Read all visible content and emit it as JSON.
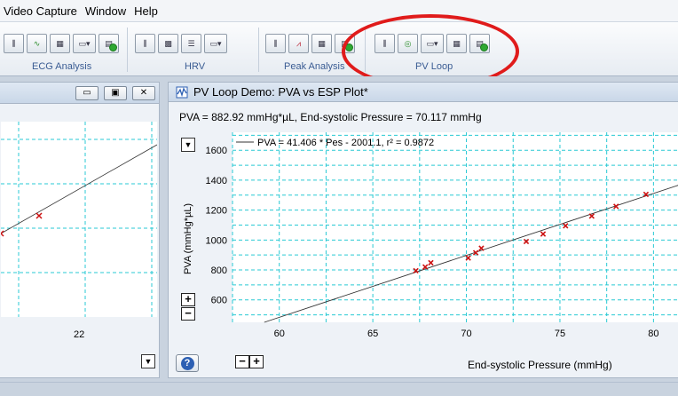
{
  "menu": {
    "items": [
      "Video Capture",
      "Window",
      "Help"
    ]
  },
  "ribbon": {
    "groups": [
      {
        "label": "ECG Analysis"
      },
      {
        "label": "HRV"
      },
      {
        "label": "Peak Analysis"
      },
      {
        "label": "PV Loop"
      }
    ],
    "annotation_color": "#e01b1b"
  },
  "left_window": {
    "minimize": "▭",
    "restore": "▣",
    "close": "✕",
    "x_tick": "22"
  },
  "main_window": {
    "title": "PV Loop Demo: PVA vs ESP Plot*",
    "status": "PVA = 882.92 mmHg*µL, End-systolic Pressure = 70.117 mmHg",
    "help_label": "?",
    "zoom_in": "+",
    "zoom_out": "−"
  },
  "chart_data": {
    "type": "scatter",
    "xlabel": "End-systolic Pressure (mmHg)",
    "ylabel": "PVA (mmHg*µL)",
    "xlim": [
      57.5,
      81.5
    ],
    "ylim": [
      450,
      1720
    ],
    "x_ticks": [
      60,
      65,
      70,
      75,
      80
    ],
    "y_ticks": [
      600,
      800,
      1000,
      1200,
      1400,
      1600
    ],
    "grid": true,
    "legend": "top-left",
    "legend_entry": "PVA = 41.406 * Pes - 2001.1, r² = 0.9872",
    "fit": {
      "slope": 41.406,
      "intercept": -2001.1
    },
    "marker_color": "#cc1111",
    "points": [
      {
        "x": 67.3,
        "y": 795
      },
      {
        "x": 67.8,
        "y": 820
      },
      {
        "x": 68.1,
        "y": 848
      },
      {
        "x": 70.1,
        "y": 880
      },
      {
        "x": 70.5,
        "y": 915
      },
      {
        "x": 70.8,
        "y": 945
      },
      {
        "x": 73.2,
        "y": 990
      },
      {
        "x": 74.1,
        "y": 1040
      },
      {
        "x": 75.3,
        "y": 1095
      },
      {
        "x": 76.7,
        "y": 1160
      },
      {
        "x": 78.0,
        "y": 1225
      },
      {
        "x": 79.6,
        "y": 1305
      }
    ]
  }
}
